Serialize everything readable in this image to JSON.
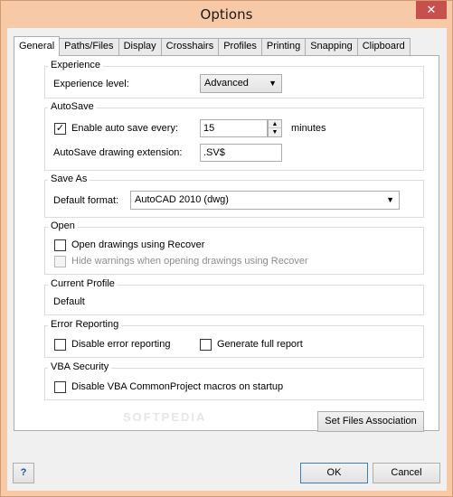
{
  "window": {
    "title": "Options",
    "close_label": "✕"
  },
  "tabs": [
    {
      "label": "General"
    },
    {
      "label": "Paths/Files"
    },
    {
      "label": "Display"
    },
    {
      "label": "Crosshairs"
    },
    {
      "label": "Profiles"
    },
    {
      "label": "Printing"
    },
    {
      "label": "Snapping"
    },
    {
      "label": "Clipboard"
    }
  ],
  "experience": {
    "title": "Experience",
    "level_label": "Experience level:",
    "level_value": "Advanced"
  },
  "autosave": {
    "title": "AutoSave",
    "enable_label": "Enable auto save every:",
    "enabled": true,
    "interval_value": "15",
    "unit_label": "minutes",
    "extension_label": "AutoSave drawing extension:",
    "extension_value": ".SV$"
  },
  "saveas": {
    "title": "Save As",
    "format_label": "Default format:",
    "format_value": "AutoCAD 2010 (dwg)"
  },
  "open": {
    "title": "Open",
    "recover_label": "Open drawings using Recover",
    "hide_warnings_label": "Hide warnings when opening drawings using Recover"
  },
  "current_profile": {
    "title": "Current Profile",
    "value": "Default"
  },
  "error_reporting": {
    "title": "Error Reporting",
    "disable_label": "Disable error reporting",
    "full_report_label": "Generate full report"
  },
  "vba_security": {
    "title": "VBA Security",
    "disable_label": "Disable VBA CommonProject macros on startup"
  },
  "buttons": {
    "set_files_association": "Set Files Association",
    "help": "?",
    "ok": "OK",
    "cancel": "Cancel"
  },
  "watermark": "SOFTPEDIA"
}
